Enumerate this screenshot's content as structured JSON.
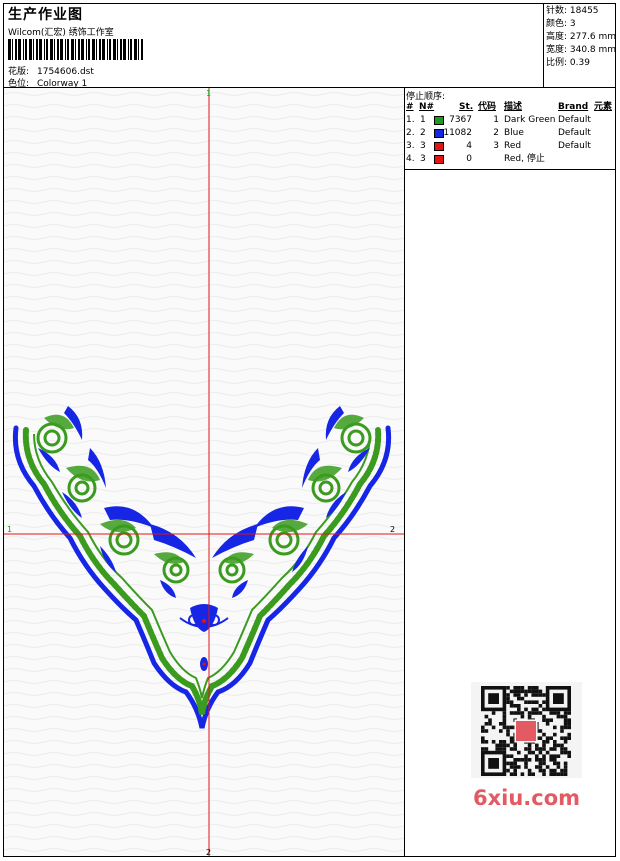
{
  "header": {
    "title": "生产作业图",
    "subtitle": "Wilcom(汇宏) 绣饰工作室",
    "file_label": "花版:",
    "file_value": "1754606.dst",
    "color_label": "色位:",
    "color_value": "Colorway 1"
  },
  "stats": {
    "stitches": "针数: 18455",
    "colors": "颜色: 3",
    "height": "高度: 277.6 mm",
    "width": "宽度: 340.8 mm",
    "scale": "比例: 0.39"
  },
  "stop_sequence": {
    "title": "停止顺序:",
    "headers": {
      "num": "#",
      "n": "N#",
      "st": "St.",
      "code": "代码",
      "desc": "描述",
      "brand": "Brand",
      "element": "元素"
    },
    "rows": [
      {
        "num": "1.",
        "n": "1",
        "color": "#1e9a1e",
        "st": "7367",
        "code": "1",
        "desc": "Dark Green",
        "brand": "Default"
      },
      {
        "num": "2.",
        "n": "2",
        "color": "#1428e0",
        "st": "11082",
        "code": "2",
        "desc": "Blue",
        "brand": "Default"
      },
      {
        "num": "3.",
        "n": "3",
        "color": "#e21414",
        "st": "4",
        "code": "3",
        "desc": "Red",
        "brand": "Default"
      },
      {
        "num": "4.",
        "n": "3",
        "color": "#e21414",
        "st": "0",
        "code": "",
        "desc": "Red, 停止",
        "brand": ""
      }
    ]
  },
  "canvas": {
    "axis_top": "1",
    "axis_bottom": "2",
    "axis_left": "1",
    "axis_right": "2"
  },
  "design_colors": {
    "green": "#3a9b1f",
    "blue": "#1626e4",
    "red": "#e01414",
    "axis": "#e21414"
  },
  "watermark": {
    "logo_text": "6xiu.com",
    "qr_icon": "qr-code-icon"
  }
}
